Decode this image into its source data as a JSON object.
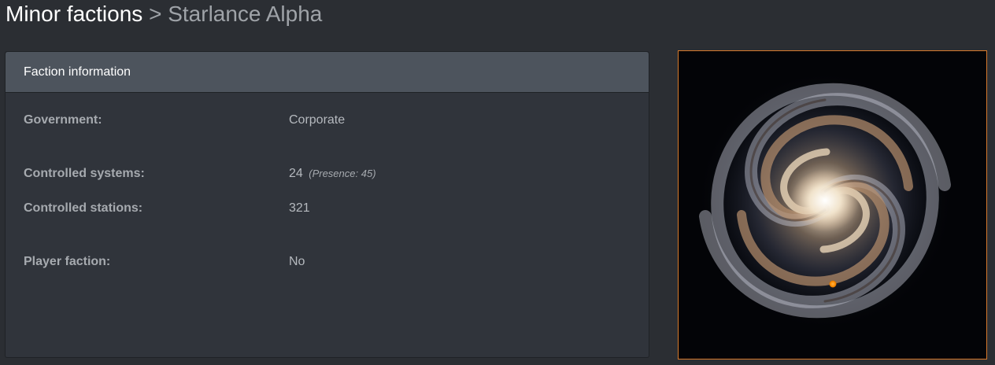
{
  "breadcrumb": {
    "parent": "Minor factions",
    "separator": ">",
    "current": "Starlance Alpha"
  },
  "panel": {
    "title": "Faction information",
    "rows": [
      {
        "label": "Government:",
        "value": "Corporate"
      },
      {
        "label": "Controlled systems:",
        "value": "24",
        "note_label": "(Presence:",
        "note_value": "45",
        "note_close": ")"
      },
      {
        "label": "Controlled stations:",
        "value": "321"
      },
      {
        "label": "Player faction:",
        "value": "No"
      }
    ]
  },
  "galaxy_map": {
    "marker_color": "#ff8c00",
    "frame_color": "#d77a2c"
  }
}
